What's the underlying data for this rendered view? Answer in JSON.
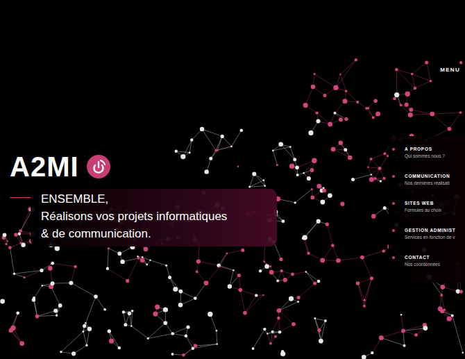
{
  "logo": {
    "text": "A2MI"
  },
  "menu": {
    "label": "MENU"
  },
  "tagline": [
    "ENSEMBLE,",
    "Réalisons vos projets informatiques",
    "& de communication."
  ],
  "nav": {
    "items": [
      {
        "title": "A PROPOS",
        "subtitle": "Qui sommes nous ?"
      },
      {
        "title": "COMMUNICATION",
        "subtitle": "Nos dernières réalisati"
      },
      {
        "title": "SITES WEB",
        "subtitle": "Formules au choix"
      },
      {
        "title": "GESTION ADMINIST",
        "subtitle": "Services en fonction de v"
      },
      {
        "title": "CONTACT",
        "subtitle": "Nos coordonnées"
      }
    ]
  }
}
